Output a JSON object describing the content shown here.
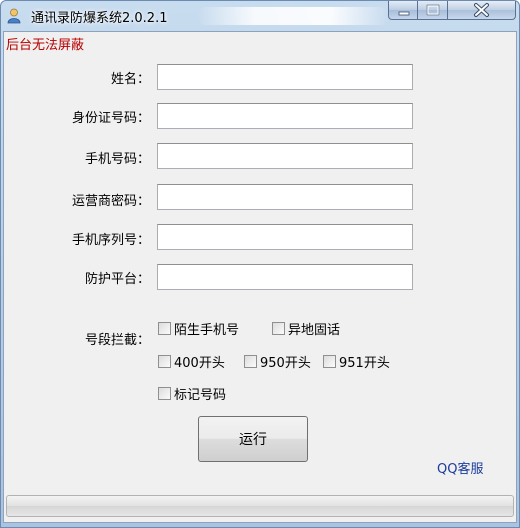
{
  "window": {
    "title": "通讯录防爆系统2.0.2.1",
    "app_icon": "user-app-icon",
    "controls": [
      "minimize-icon",
      "maximize-icon",
      "close-icon"
    ]
  },
  "notice": "后台无法屏蔽",
  "form": {
    "fields": [
      {
        "label": "姓名：",
        "value": ""
      },
      {
        "label": "身份证号码：",
        "value": ""
      },
      {
        "label": "手机号码：",
        "value": ""
      },
      {
        "label": "运营商密码：",
        "value": ""
      },
      {
        "label": "手机序列号：",
        "value": ""
      },
      {
        "label": "防护平台：",
        "value": ""
      }
    ],
    "intercept_label": "号段拦截：",
    "options": [
      {
        "label": "陌生手机号",
        "checked": false
      },
      {
        "label": "异地固话",
        "checked": false
      },
      {
        "label": "400开头",
        "checked": false
      },
      {
        "label": "950开头",
        "checked": false
      },
      {
        "label": "951开头",
        "checked": false
      },
      {
        "label": "标记号码",
        "checked": false
      }
    ]
  },
  "run_button": "运行",
  "support_link": "QQ客服",
  "progress": {
    "value": 0
  },
  "colors": {
    "notice": "#b80000",
    "link": "#1a3c9c"
  }
}
